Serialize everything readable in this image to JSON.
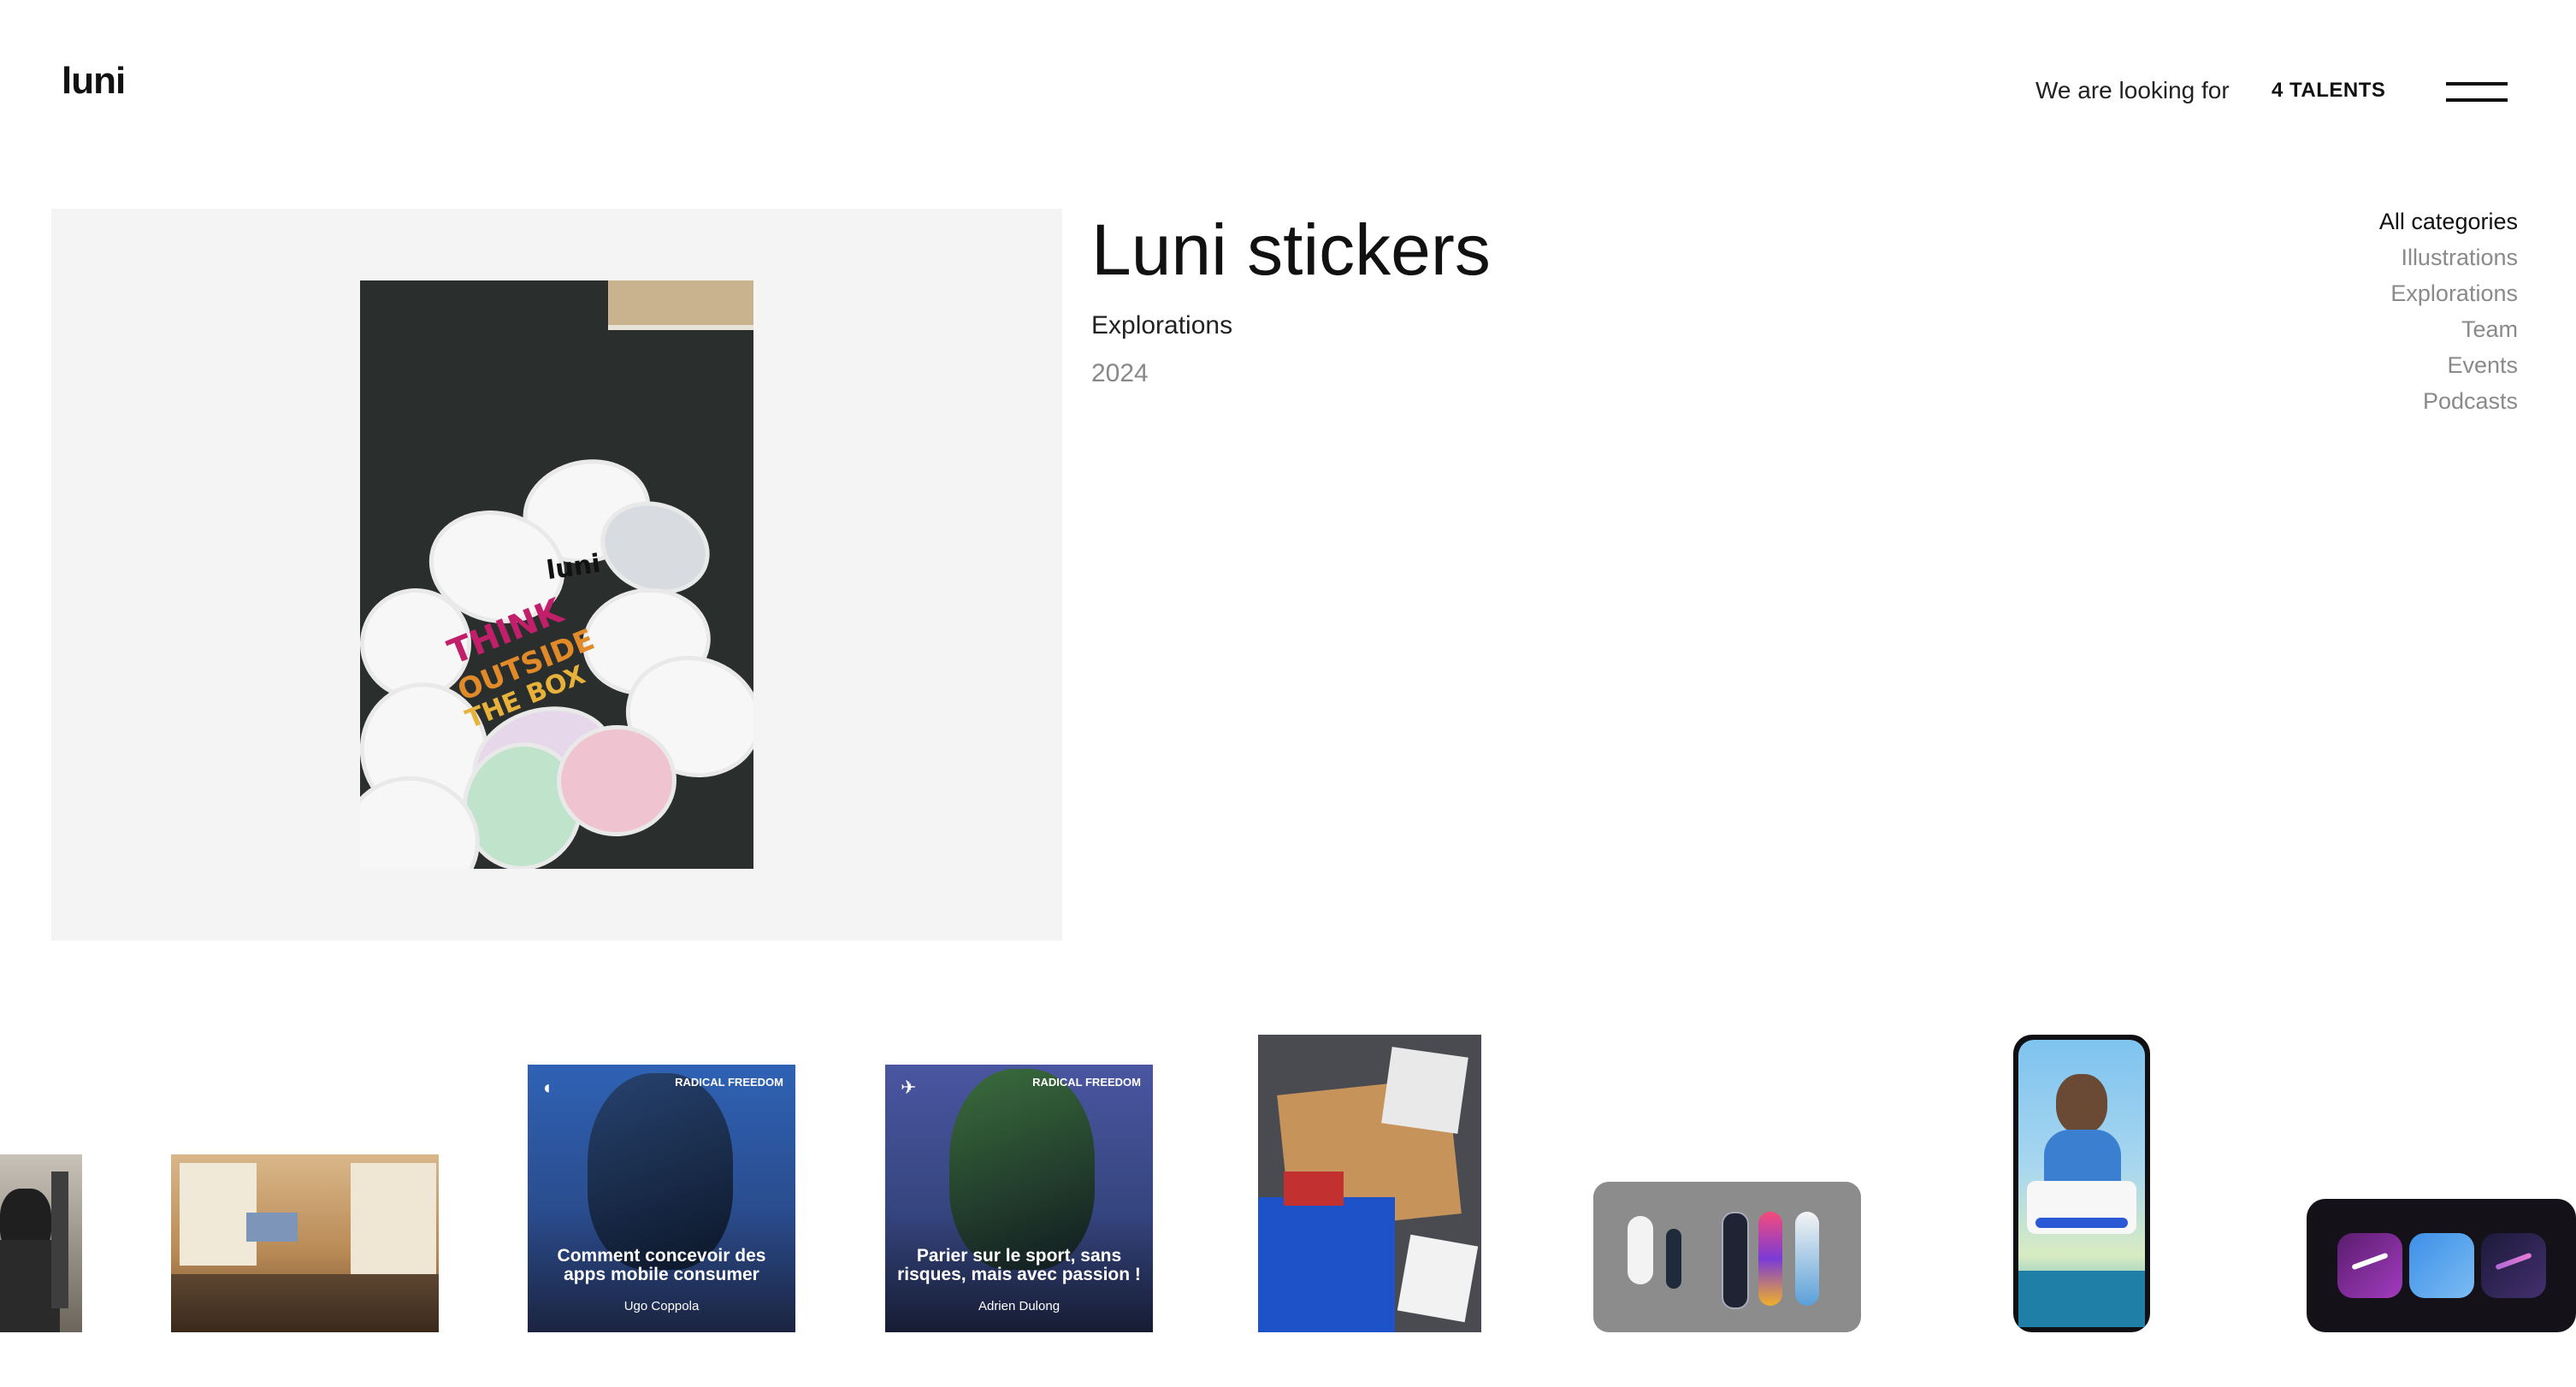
{
  "header": {
    "logo": "luni",
    "hiring_label": "We are looking for",
    "talents_label": "4 TALENTS"
  },
  "project": {
    "title": "Luni stickers",
    "category": "Explorations",
    "year": "2024",
    "sticker_texts": [
      "luni",
      "THINK",
      "OUTSIDE",
      "THE BOX"
    ]
  },
  "categories": {
    "items": [
      "All categories",
      "Illustrations",
      "Explorations",
      "Team",
      "Events",
      "Podcasts"
    ],
    "active": "All categories"
  },
  "podcasts": [
    {
      "badge": "RADICAL FREEDOM",
      "title": "Comment concevoir des apps mobile consumer",
      "author": "Ugo Coppola"
    },
    {
      "badge": "RADICAL FREEDOM",
      "title": "Parier sur le sport, sans risques, mais avec passion !",
      "author": "Adrien Dulong"
    }
  ],
  "colors": {
    "hero_bg": "#f4f4f4",
    "text_primary": "#111111",
    "text_muted": "#888888",
    "podcast1_bg": "#2d5fa8",
    "podcast2_bg": "#3c4a86"
  }
}
